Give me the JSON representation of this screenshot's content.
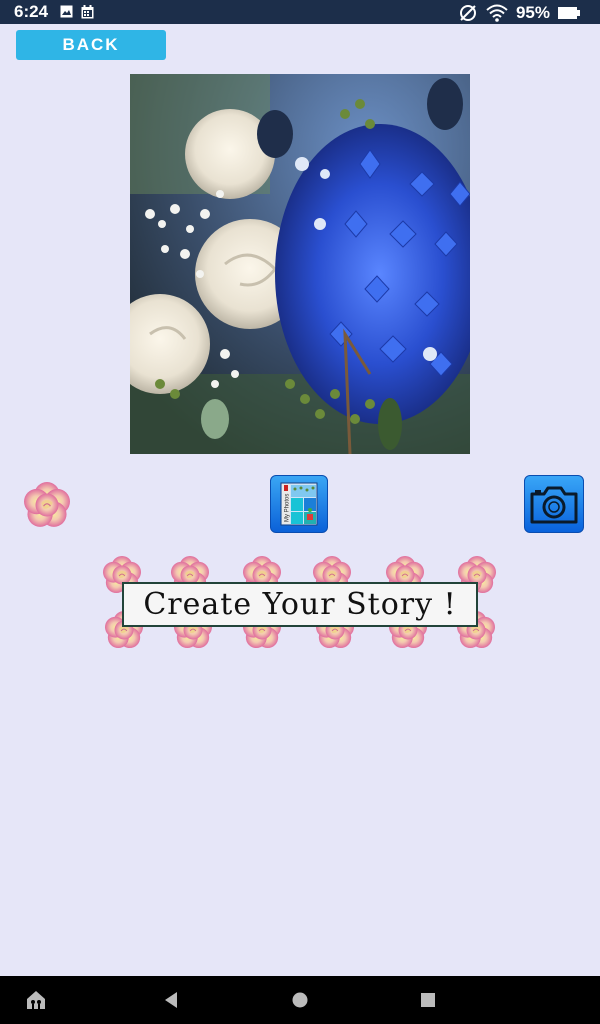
{
  "status_bar": {
    "time": "6:24",
    "battery": "95%",
    "icons": [
      "image-icon",
      "calendar-icon",
      "no-sim-icon",
      "wifi-icon",
      "battery-icon"
    ]
  },
  "back_button": {
    "label": "BACK"
  },
  "story": {
    "title": "Create Your Story !"
  },
  "myphotos_button": {
    "label": "My Photos"
  },
  "nav_bar": {
    "icons": [
      "home-icon",
      "back-triangle-icon",
      "home-circle-icon",
      "recents-square-icon"
    ]
  },
  "colors": {
    "background": "#e6e6f8",
    "status_bar": "#1c2e4a",
    "back_button": "#2fb5e6",
    "button_blue": "#0b61d8",
    "rose_pink": "#e87fa8",
    "rose_yellow": "#f3de8f"
  }
}
